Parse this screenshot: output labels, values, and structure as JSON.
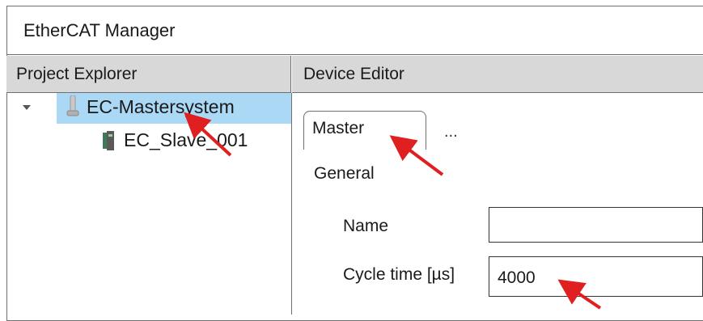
{
  "window": {
    "title": "EtherCAT Manager"
  },
  "project_explorer": {
    "header": "Project Explorer",
    "tree": [
      {
        "label": "EC-Mastersystem",
        "icon": "master-system-icon",
        "expanded": true,
        "selected": true
      },
      {
        "label": "EC_Slave_001",
        "icon": "slave-device-icon",
        "selected": false
      }
    ]
  },
  "device_editor": {
    "header": "Device Editor",
    "tabs": [
      {
        "label": "Master",
        "active": true
      },
      {
        "label": "..."
      }
    ],
    "section": "General",
    "fields": {
      "name": {
        "label": "Name",
        "value": ""
      },
      "cycle_time": {
        "label": "Cycle time [µs]",
        "value": "4000"
      }
    }
  },
  "colors": {
    "selection": "#aad8f5",
    "header_bg": "#d8d8d8",
    "arrow": "#e02020"
  }
}
